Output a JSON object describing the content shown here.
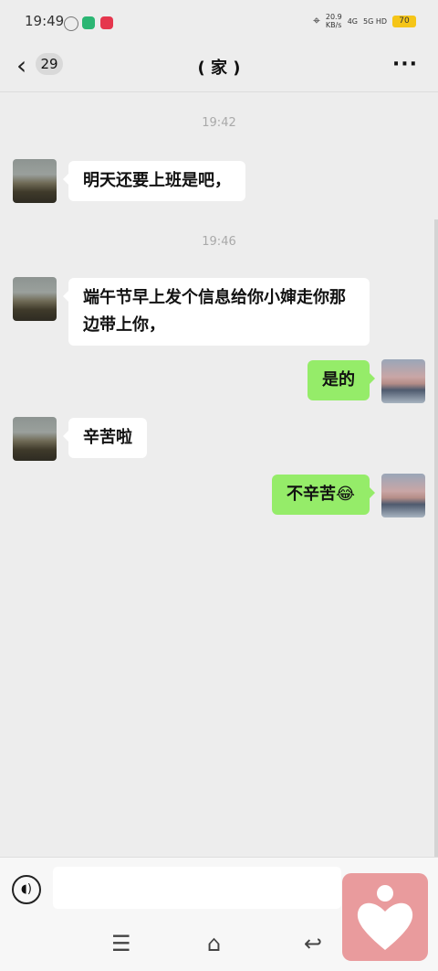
{
  "status": {
    "time": "19:49",
    "speed": "20.9",
    "speed_unit": "KB/s",
    "net1": "4G",
    "net2": "5G HD",
    "battery": "70"
  },
  "header": {
    "unread": "29",
    "title": "( 家 )",
    "more": "···"
  },
  "messages": [
    {
      "type": "time",
      "text": "19:42"
    },
    {
      "side": "left",
      "text": "明天还要上班是吧，"
    },
    {
      "type": "time",
      "text": "19:46"
    },
    {
      "side": "left",
      "text": "端午节早上发个信息给你小婶走你那边带上你，"
    },
    {
      "side": "right",
      "text": "是的"
    },
    {
      "side": "left",
      "text": "辛苦啦"
    },
    {
      "side": "right",
      "text": "不辛苦😂"
    }
  ],
  "input": {
    "placeholder": ""
  }
}
